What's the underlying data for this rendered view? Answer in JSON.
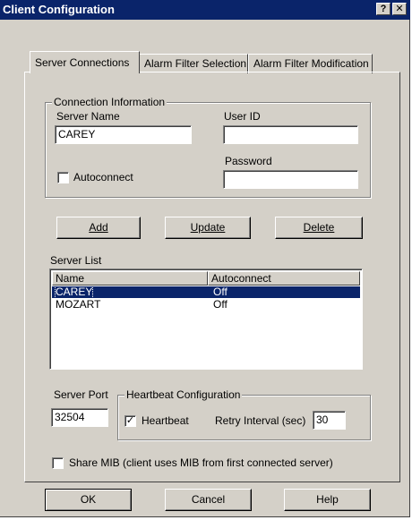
{
  "window": {
    "title": "Client Configuration",
    "help_glyph": "?",
    "close_glyph": "✕"
  },
  "tabs": [
    {
      "label": "Server Connections",
      "active": true
    },
    {
      "label": "Alarm Filter Selection",
      "active": false
    },
    {
      "label": "Alarm Filter Modification",
      "active": false
    }
  ],
  "connection": {
    "group_label": "Connection Information",
    "server_name_label": "Server Name",
    "server_name_value": "CAREY",
    "user_id_label": "User ID",
    "user_id_value": "",
    "password_label": "Password",
    "password_value": "",
    "autoconnect_label": "Autoconnect",
    "autoconnect_checked": false
  },
  "actions": {
    "add_label": "Add",
    "update_label": "Update",
    "delete_label": "Delete"
  },
  "server_list": {
    "label": "Server List",
    "columns": [
      "Name",
      "Autoconnect"
    ],
    "rows": [
      {
        "name": "CAREY",
        "autoconnect": "Off",
        "selected": true
      },
      {
        "name": "MOZART",
        "autoconnect": "Off",
        "selected": false
      }
    ]
  },
  "port": {
    "label": "Server Port",
    "value": "32504"
  },
  "heartbeat": {
    "group_label": "Heartbeat Configuration",
    "heartbeat_label": "Heartbeat",
    "heartbeat_checked": true,
    "check_glyph": "✓",
    "retry_label": "Retry Interval (sec)",
    "retry_value": "30"
  },
  "share_mib": {
    "label": "Share MIB (client uses MIB from first connected server)",
    "checked": false
  },
  "footer": {
    "ok_label": "OK",
    "cancel_label": "Cancel",
    "help_label": "Help"
  },
  "colors": {
    "titlebar": "#0a246a",
    "face": "#d4d0c8",
    "selection": "#0a246a"
  }
}
